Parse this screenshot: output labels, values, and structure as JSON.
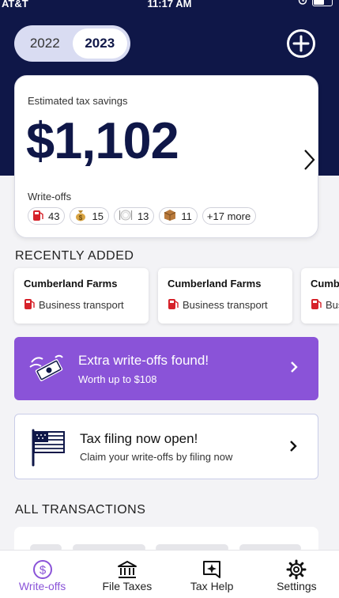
{
  "status_bar": {
    "carrier": "AT&T",
    "time": "11:17 AM"
  },
  "year_toggle": {
    "options": [
      "2022",
      "2023"
    ],
    "selected": "2023"
  },
  "savings_card": {
    "label": "Estimated tax savings",
    "amount": "$1,102",
    "writeoffs_label": "Write-offs",
    "chips": [
      {
        "icon": "fuel-pump-icon",
        "count": "43"
      },
      {
        "icon": "money-bag-icon",
        "count": "15"
      },
      {
        "icon": "plate-utensils-icon",
        "count": "13"
      },
      {
        "icon": "package-icon",
        "count": "11"
      },
      {
        "label": "+17 more"
      }
    ]
  },
  "recently_added": {
    "title": "RECENTLY ADDED",
    "items": [
      {
        "merchant": "Cumberland Farms",
        "category": "Business transport"
      },
      {
        "merchant": "Cumberland Farms",
        "category": "Business transport"
      },
      {
        "merchant": "Cumberland Farms",
        "category": "Business transport"
      }
    ]
  },
  "promo": {
    "title": "Extra write-offs found!",
    "subtitle": "Worth up to $108",
    "color": "#8a53d8"
  },
  "filing": {
    "title": "Tax filing now open!",
    "subtitle": "Claim your write-offs by filing now"
  },
  "all_transactions": {
    "title": "ALL TRANSACTIONS"
  },
  "tabbar": {
    "tabs": [
      {
        "label": "Write-offs",
        "icon": "dollar-circle-icon",
        "active": true
      },
      {
        "label": "File Taxes",
        "icon": "bank-icon",
        "active": false
      },
      {
        "label": "Tax Help",
        "icon": "sparkle-badge-icon",
        "active": false
      },
      {
        "label": "Settings",
        "icon": "gear-icon",
        "active": false
      }
    ]
  },
  "colors": {
    "navy": "#0f1748",
    "accent_purple": "#8a53d8"
  }
}
